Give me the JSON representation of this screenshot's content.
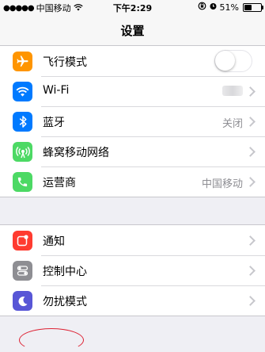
{
  "status_bar": {
    "signal": "●●●●●",
    "carrier": "中国移动",
    "time": "下午2:29",
    "battery_text": "51%",
    "battery_level": 0.51
  },
  "nav": {
    "title": "设置"
  },
  "groups": [
    {
      "items": [
        {
          "label": "飞行模式",
          "icon": "airplane-icon",
          "color": "#ff9500",
          "accessory": "toggle",
          "toggle_on": false
        },
        {
          "label": "Wi-Fi",
          "icon": "wifi-icon",
          "color": "#007aff",
          "accessory": "chevron",
          "value_redacted": true
        },
        {
          "label": "蓝牙",
          "icon": "bluetooth-icon",
          "color": "#007aff",
          "accessory": "chevron",
          "value": "关闭"
        },
        {
          "label": "蜂窝移动网络",
          "icon": "cellular-icon",
          "color": "#4cd964",
          "accessory": "chevron"
        },
        {
          "label": "运营商",
          "icon": "phone-icon",
          "color": "#4cd964",
          "accessory": "chevron",
          "value": "中国移动"
        }
      ]
    },
    {
      "items": [
        {
          "label": "通知",
          "icon": "notifications-icon",
          "color": "#ff3b30",
          "accessory": "chevron"
        },
        {
          "label": "控制中心",
          "icon": "control-center-icon",
          "color": "#8e8e93",
          "accessory": "chevron"
        },
        {
          "label": "勿扰模式",
          "icon": "moon-icon",
          "color": "#5856d6",
          "accessory": "chevron"
        }
      ]
    }
  ]
}
